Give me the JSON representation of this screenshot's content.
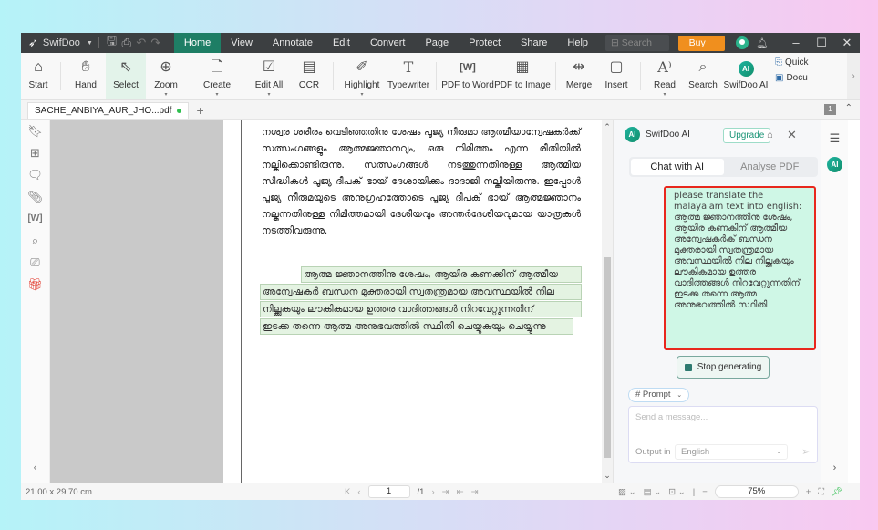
{
  "titlebar": {
    "app_name": "SwifDoo",
    "menu": [
      "Home",
      "View",
      "Annotate",
      "Edit",
      "Convert",
      "Page",
      "Protect",
      "Share",
      "Help"
    ],
    "active_menu": "Home",
    "search_placeholder": "Search Tools",
    "buy_pro": "Buy Pro"
  },
  "ribbon": {
    "groups": [
      [
        "Start"
      ],
      [
        "Hand",
        "Select",
        "Zoom"
      ],
      [
        "Create"
      ],
      [
        "Edit All",
        "OCR"
      ],
      [
        "Highlight",
        "Typewriter"
      ],
      [
        "PDF to Word",
        "PDF to Image"
      ],
      [
        "Merge",
        "Insert"
      ],
      [
        "Read",
        "Search",
        "SwifDoo AI"
      ]
    ],
    "start": "Start",
    "hand": "Hand",
    "select": "Select",
    "zoom": "Zoom",
    "create": "Create",
    "edit_all": "Edit All",
    "ocr": "OCR",
    "highlight": "Highlight",
    "typewriter": "Typewriter",
    "pdf_to_word": "PDF to Word",
    "pdf_to_image": "PDF to Image",
    "merge": "Merge",
    "insert": "Insert",
    "read": "Read",
    "search": "Search",
    "swifdoo_ai": "SwifDoo AI",
    "quick": "Quick",
    "docu": "Docu",
    "selected_tool": "Select"
  },
  "tabs": {
    "doc_tab": "SACHE_ANBIYA_AUR_JHO...pdf",
    "page_indicator": "1"
  },
  "document": {
    "paragraph": "നശ്വര ശരീരം വെടിഞ്ഞതിനു ശേഷം പൂജ്യ നീരുമാ ആത്മീയാന്വേഷകർക്ക് സത്സംഗങ്ങളും ആത്മജ്ഞാനവും, ഒരു നിമിത്തം എന്ന രീതിയിൽ നല്കിക്കൊണ്ടിരുന്നു. സത്സംഗങ്ങൾ നടത്തുന്നതിനുള്ള ആത്മീയ സിദ്ധികൾ പൂജ്യ ദീപക് ഭായ് ദേശായിക്കും ദാദാജി നല്കിയിരുന്നു. ഇപ്പോൾ പൂജ്യ നീരുമയുടെ അനുഗ്രഹത്തോടെ പൂജ്യ ദീപക് ഭായ് ആത്മജ്ഞാനം നല്കുന്നതിനുള്ള നിമിത്തമായി ദേശീയവും അന്തർദേശീയവുമായ യാത്രകൾ നടത്തിവരുന്നു.",
    "highlighted_lines": [
      "ആത്മ ജ്ഞാനത്തിനു ശേഷം, ആയിര കണക്കിന് ആത്മീയ",
      "അന്വേഷകർ ബന്ധന മുക്തരായി സ്വതന്ത്രമായ അവസ്ഥയിൽ നില",
      "നില്ക്കുകയും ലൗകികമായ ഉത്തര വാദിത്തങ്ങൾ നിറവേറ്റുന്നതിന്",
      "ഇടക്ക തന്നെ ആത്മ അനുഭവത്തിൽ സ്ഥിതി ചെയ്യുകയും ചെയ്യുന്നു"
    ]
  },
  "ai_panel": {
    "title": "SwifDoo AI",
    "upgrade": "Upgrade",
    "tabs": [
      "Chat with AI",
      "Analyse PDF"
    ],
    "active_tab": "Chat with AI",
    "user_message": "please translate the malayalam text into english: ആത്മ ജ്ഞാനത്തിനു ശേഷം, ആയിര കണകിന് ആത്മീയ അന്വേഷകർക് ബന്ധന മുക്തരായി സ്വതന്ത്രമായ അവസ്ഥയിൽ നില നില്ക്കകയും ലൗകികമായ ഉത്തര വാദിത്തങ്ങൾ നിറവേറ്റുന്നതിന് ഇടക്ക തന്നെ ആത്മ അനുഭവത്തിൽ സ്ഥിതി",
    "stop_button": "Stop generating",
    "prompt_chip": "# Prompt",
    "input_placeholder": "Send a message...",
    "output_label": "Output in",
    "output_language": "English"
  },
  "statusbar": {
    "page_size": "21.00 x 29.70 cm",
    "current_page": "1",
    "total_pages": "/1",
    "zoom": "75%"
  },
  "icons": {
    "start": "⌂",
    "hand": "✋",
    "select": "⇱",
    "zoom": "⊕",
    "create": "🗋",
    "edit_all": "✎",
    "ocr": "▤",
    "highlight": "🖍",
    "typewriter": "T",
    "pdf_to_word": "W",
    "pdf_to_image": "▦",
    "merge": "⇹",
    "insert": "▢",
    "read": "A",
    "search": "⌕"
  },
  "colors": {
    "accent": "#1e7e65",
    "buy_pro": "#f08f1e",
    "message_bg": "#cff7e6",
    "message_border": "#e8271d",
    "highlight_bg": "#e4f3e2"
  }
}
